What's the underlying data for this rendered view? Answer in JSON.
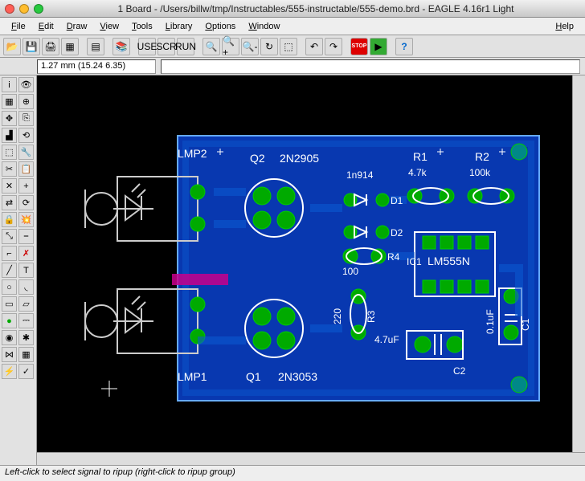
{
  "window": {
    "title": "1 Board - /Users/billw/tmp/Instructables/555-instructable/555-demo.brd - EAGLE 4.16r1 Light"
  },
  "menu": {
    "file": "File",
    "edit": "Edit",
    "draw": "Draw",
    "view": "View",
    "tools": "Tools",
    "library": "Library",
    "options": "Options",
    "window": "Window",
    "help": "Help"
  },
  "coord": {
    "value": "1.27 mm (15.24 6.35)",
    "cmd": ""
  },
  "pcb": {
    "labels": {
      "lmp2": "LMP2",
      "lmp1": "LMP1",
      "q2": "Q2",
      "q2v": "2N2905",
      "q1": "Q1",
      "q1v": "2N3053",
      "d1": "D1",
      "d2": "D2",
      "dtype": "1n914",
      "r1": "R1",
      "r1v": "4.7k",
      "r2": "R2",
      "r2v": "100k",
      "r3": "R3",
      "r3v": "4.7uF",
      "r4": "R4",
      "r4v": "100",
      "r3val": "220",
      "ic1": "IC1",
      "ic1v": "LM555N",
      "c1": "C1",
      "c1v": "0.1uF",
      "c2": "C2"
    }
  },
  "status": {
    "text": "Left-click to select signal to ripup (right-click to ripup group)"
  }
}
